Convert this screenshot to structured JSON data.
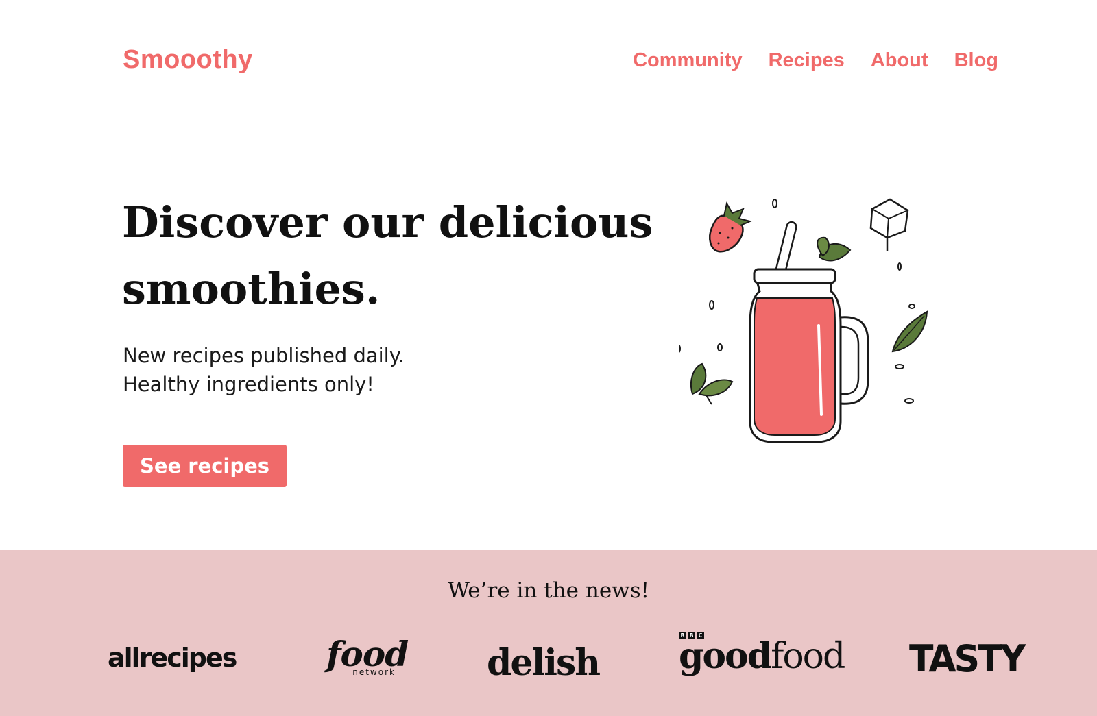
{
  "header": {
    "logo": "Smooothy",
    "nav": [
      "Community",
      "Recipes",
      "About",
      "Blog"
    ]
  },
  "hero": {
    "title": "Discover our delicious smoothies.",
    "subtitle_lines": [
      "New recipes published daily.",
      "Healthy ingredients only!"
    ],
    "cta_label": "See recipes"
  },
  "news": {
    "title": "We’re in the news!",
    "brands": {
      "allrecipes": "allrecipes",
      "food_main": "food",
      "food_sub": "network",
      "delish": "delish",
      "goodfood_prefix": "BBC",
      "goodfood_good": "good",
      "goodfood_food": "food",
      "tasty": "TASTY"
    }
  },
  "colors": {
    "accent": "#f06a6a",
    "news_background": "#eac6c7",
    "text": "#111111"
  }
}
